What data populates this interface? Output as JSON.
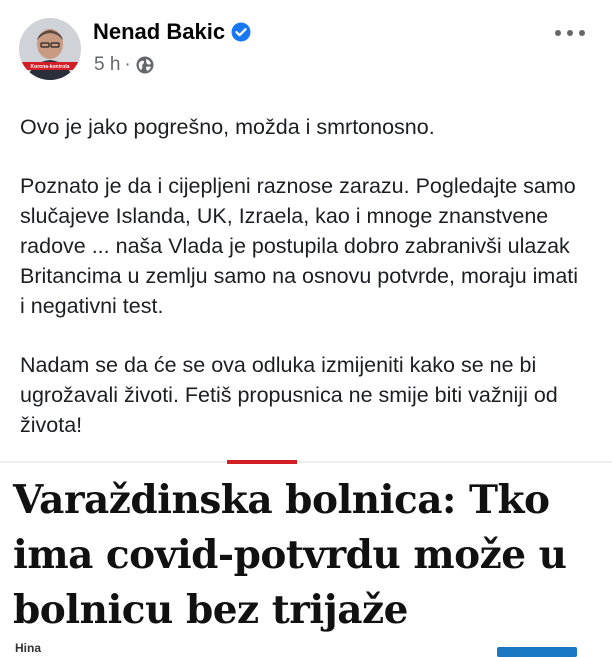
{
  "post": {
    "author": "Nenad Bakic",
    "time": "5 h",
    "separator": "·",
    "privacy_icon": "globe-icon",
    "verified_icon": "verified-badge-icon",
    "more_icon": "more-options-icon",
    "avatar_caption": "Korona-kontrola",
    "paragraphs": [
      "Ovo je jako pogrešno, možda i smrtonosno.",
      "Poznato je da i cijepljeni raznose zarazu. Pogledajte samo slučajeve Islanda, UK, Izraela, kao i mnoge znanstvene radove ... naša Vlada je postupila dobro zabranivši ulazak Britancima u zemlju samo na osnovu potvrde, moraju imati i negativni test.",
      "Nadam se da će se ova odluka izmijeniti kako se ne bi ugrožavali životi. Fetiš propusnica ne smije biti važniji od života!"
    ]
  },
  "article": {
    "headline": "Varaždinska bolnica: Tko ima covid-potvrdu može u bolnicu bez trijaže",
    "source": "Hina"
  },
  "colors": {
    "verified": "#1877f2",
    "accent_red": "#d21f26",
    "meta_gray": "#65676b",
    "button_blue": "#1a78c2"
  }
}
